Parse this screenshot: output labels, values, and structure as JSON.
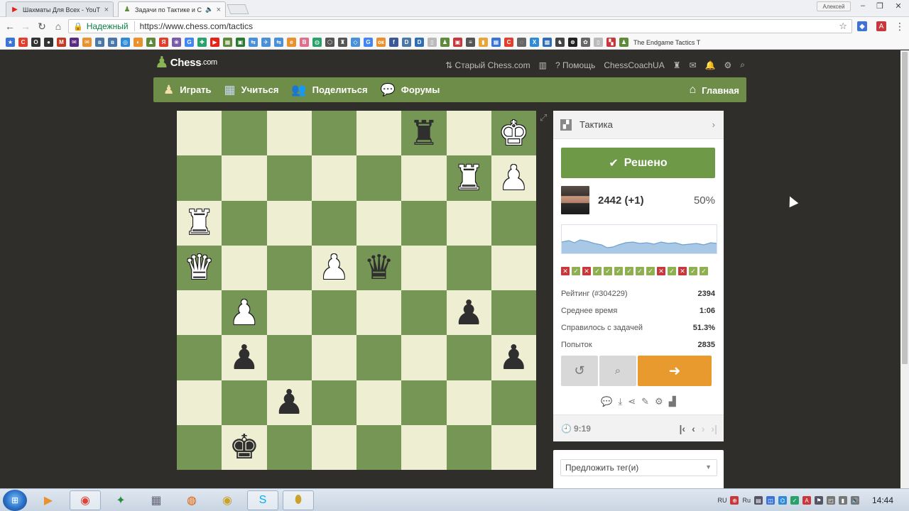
{
  "browser": {
    "tabs": [
      {
        "title": "Шахматы Для Всех - YouT",
        "icon": "youtube-icon",
        "active": false
      },
      {
        "title": "Задачи по Тактике и С",
        "icon": "chess-pawn-icon",
        "active": true,
        "sound": "speaker-icon"
      }
    ],
    "user_label": "Алексей",
    "address": {
      "secure_label": "Надежный",
      "url": "https://www.chess.com/tactics"
    },
    "bookmark_last_label": "The Endgame Tactics T"
  },
  "site": {
    "logo_text": "Chess",
    "logo_suffix": ".com",
    "toplinks": {
      "old_chess": "Старый Chess.com",
      "help": "Помощь",
      "username": "ChessCoachUA"
    },
    "nav": {
      "play": "Играть",
      "learn": "Учиться",
      "share": "Поделиться",
      "forums": "Форумы",
      "home": "Главная"
    }
  },
  "board": {
    "ranks": [
      [
        "",
        "",
        "",
        "",
        "",
        "bR",
        "",
        "wK"
      ],
      [
        "",
        "",
        "",
        "",
        "",
        "",
        "wR",
        "wP"
      ],
      [
        "wR",
        "",
        "",
        "",
        "",
        "",
        "",
        ""
      ],
      [
        "wQ",
        "",
        "",
        "wP",
        "bQ",
        "",
        "",
        ""
      ],
      [
        "",
        "wP",
        "",
        "",
        "",
        "",
        "bP",
        ""
      ],
      [
        "",
        "bP",
        "",
        "",
        "",
        "",
        "",
        "bP"
      ],
      [
        "",
        "",
        "bP",
        "",
        "",
        "",
        "",
        ""
      ],
      [
        "",
        "bK",
        "",
        "",
        "",
        "",
        "",
        ""
      ]
    ],
    "glyphs": {
      "K": "♚",
      "Q": "♛",
      "R": "♜",
      "B": "♝",
      "N": "♞",
      "P": "♟"
    },
    "light_color": "#eeeed2",
    "dark_color": "#769656"
  },
  "panel": {
    "title": "Тактика",
    "solved_label": "Решено",
    "rating_line": "2442 (+1)",
    "percent": "50%",
    "results": [
      "no",
      "ok",
      "no",
      "ok",
      "ok",
      "ok",
      "ok",
      "ok",
      "ok",
      "no",
      "ok",
      "no",
      "ok",
      "ok"
    ],
    "stats": [
      {
        "label": "Рейтинг (#304229)",
        "value": "2394"
      },
      {
        "label": "Среднее время",
        "value": "1:06"
      },
      {
        "label": "Справилось с задачей",
        "value": "51.3%"
      },
      {
        "label": "Попыток",
        "value": "2835"
      }
    ],
    "timer": "9:19",
    "tag_placeholder": "Предложить тег(и)"
  },
  "taskbar": {
    "lang": "RU",
    "lang2": "Ru",
    "clock": "14:44"
  },
  "colors": {
    "nav_green": "#6e8d49",
    "solved_green": "#6e9a48",
    "next_orange": "#e89a2f",
    "page_bg": "#302e2b"
  }
}
